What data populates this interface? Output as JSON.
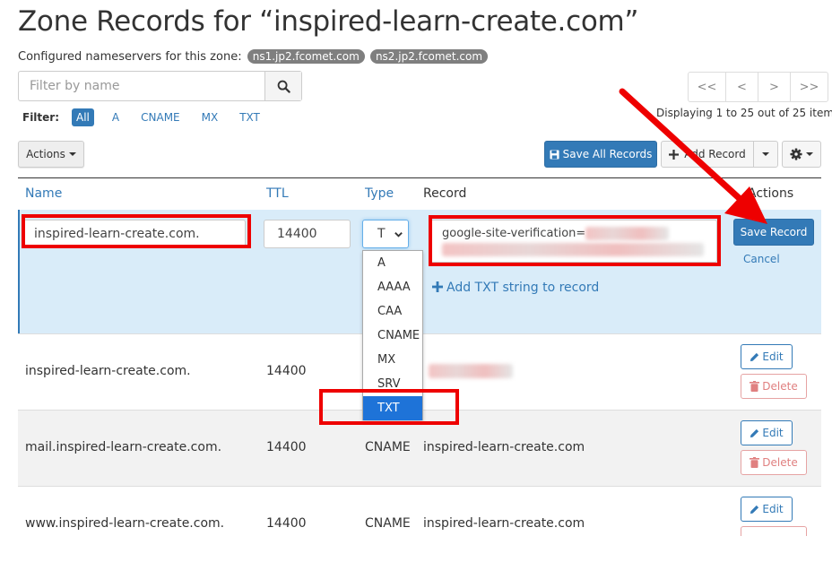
{
  "page": {
    "title": "Zone Records for “inspired-learn-create.com”",
    "nameservers_label": "Configured nameservers for this zone:",
    "nameservers": [
      "ns1.jp2.fcomet.com",
      "ns2.jp2.fcomet.com"
    ]
  },
  "filter": {
    "placeholder": "Filter by name",
    "label": "Filter:",
    "chips": [
      "All",
      "A",
      "CNAME",
      "MX",
      "TXT"
    ]
  },
  "pager": {
    "buttons": [
      "<<",
      "<",
      ">",
      ">>"
    ],
    "display_text": "Displaying 1 to 25 out of 25 items"
  },
  "toolbar": {
    "actions_label": "Actions",
    "save_all_label": "Save All Records",
    "add_record_label": "Add Record"
  },
  "table": {
    "headers": [
      "Name",
      "TTL",
      "Type",
      "Record",
      "Actions"
    ],
    "edit_row": {
      "name": "inspired-learn-create.com.",
      "ttl": "14400",
      "type_shown": "T",
      "record_prefix": "google-site-verification=",
      "add_txt_label": "Add TXT string to record",
      "save_label": "Save Record",
      "cancel_label": "Cancel"
    },
    "type_options": [
      "A",
      "AAAA",
      "CAA",
      "CNAME",
      "MX",
      "SRV",
      "TXT"
    ],
    "rows": [
      {
        "name": "inspired-learn-create.com.",
        "ttl": "14400",
        "type": "",
        "record": ""
      },
      {
        "name": "mail.inspired-learn-create.com.",
        "ttl": "14400",
        "type": "CNAME",
        "record": "inspired-learn-create.com"
      },
      {
        "name": "www.inspired-learn-create.com.",
        "ttl": "14400",
        "type": "CNAME",
        "record": "inspired-learn-create.com"
      }
    ],
    "edit_label": "Edit",
    "delete_label": "Delete"
  },
  "colors": {
    "accent": "#337ab7",
    "edit_row_bg": "#d9ecf9",
    "annotation_red": "#ee0000",
    "delete_red": "#e08080"
  }
}
